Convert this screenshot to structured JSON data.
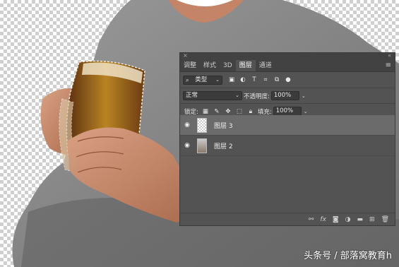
{
  "panel": {
    "tabs": [
      "调整",
      "样式",
      "3D",
      "图层",
      "通道"
    ],
    "active_tab": "图层",
    "filter": {
      "label": "类型"
    },
    "blend_mode": "正常",
    "opacity_label": "不透明度:",
    "opacity_value": "100%",
    "lock_label": "锁定:",
    "fill_label": "填充:",
    "fill_value": "100%",
    "layers": [
      {
        "name": "图层 3",
        "selected": true
      },
      {
        "name": "图层 2",
        "selected": false
      }
    ],
    "footer_icons": [
      "link-icon",
      "fx-icon",
      "mask-icon",
      "adjustment-icon",
      "folder-icon",
      "new-layer-icon",
      "trash-icon"
    ]
  },
  "watermark": "头条号 / 部落窝教育h",
  "colors": {
    "panel_bg": "#535353",
    "selected_layer": "#6b6b6b",
    "shirt": "#8c8c8c",
    "skin": "#c78b6c"
  }
}
